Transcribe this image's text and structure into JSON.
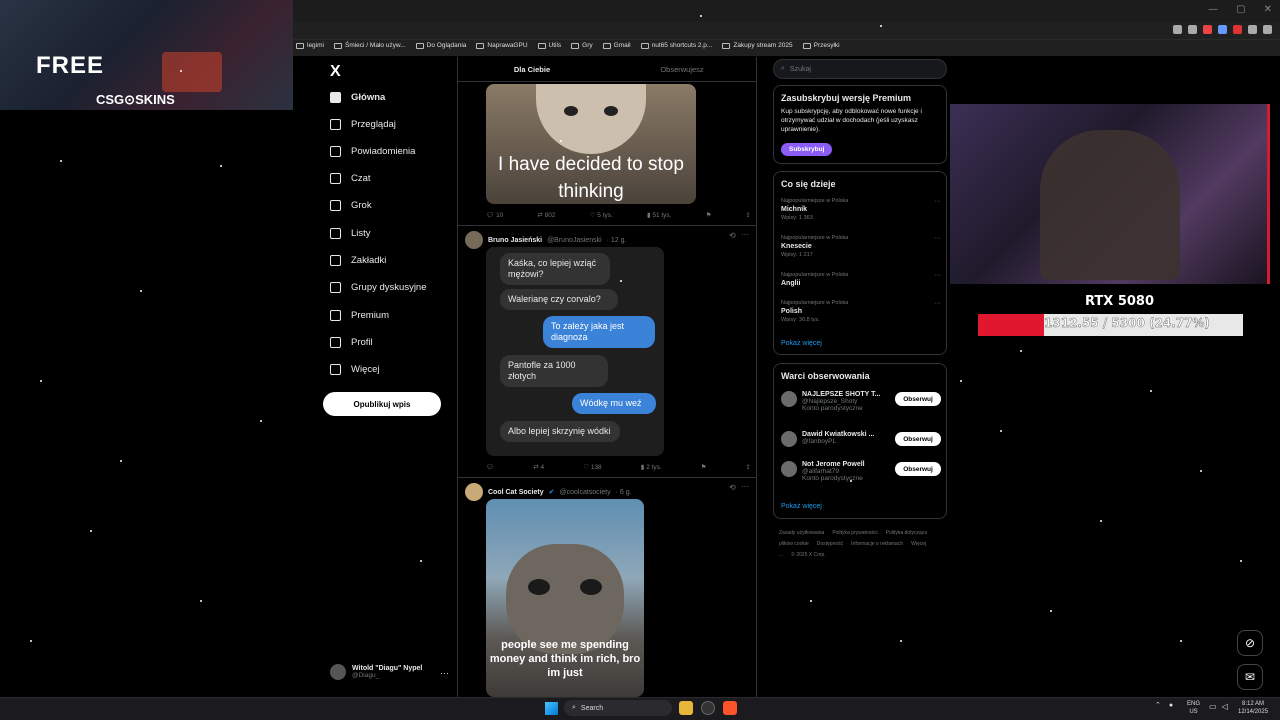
{
  "bookmarks": [
    "legimi",
    "Śmieci / Mało używ...",
    "Do Oglądania",
    "NaprawaGPU",
    "Utils",
    "Gry",
    "Gmail",
    "nut65 shortcuts 2.p...",
    "Zakupy stream 2025",
    "Przesyłki"
  ],
  "promo": {
    "headline": "FREE",
    "brand": "CSG⊙SKINS"
  },
  "sidebar": {
    "logo": "X",
    "items": [
      {
        "label": "Główna",
        "icon": "home-icon"
      },
      {
        "label": "Przeglądaj",
        "icon": "search-icon"
      },
      {
        "label": "Powiadomienia",
        "icon": "bell-icon"
      },
      {
        "label": "Czat",
        "icon": "mail-icon"
      },
      {
        "label": "Grok",
        "icon": "grok-icon"
      },
      {
        "label": "Listy",
        "icon": "list-icon"
      },
      {
        "label": "Zakładki",
        "icon": "bookmark-icon"
      },
      {
        "label": "Grupy dyskusyjne",
        "icon": "people-icon"
      },
      {
        "label": "Premium",
        "icon": "x-icon"
      },
      {
        "label": "Profil",
        "icon": "user-icon"
      },
      {
        "label": "Więcej",
        "icon": "more-icon"
      }
    ],
    "post_button": "Opublikuj wpis",
    "account": {
      "name": "Witold \"Diagu\" Nypel",
      "handle": "@Diagu_"
    }
  },
  "feed": {
    "tabs": [
      "Dla Ciebie",
      "Obserwujesz"
    ],
    "post1": {
      "image_text": "I have decided to stop thinking",
      "replies": "10",
      "reposts": "802",
      "likes": "5 tys.",
      "views": "51 tys."
    },
    "post2": {
      "author": "Bruno Jasieński",
      "handle": "@BrunoJasienski",
      "time": "· 12 g.",
      "messages": [
        {
          "text": "Kaśka, co lepiej wziąć mężowi?",
          "dir": "in"
        },
        {
          "text": "Walerianę czy corvalo?",
          "dir": "in"
        },
        {
          "text": "To zależy jaka jest diagnoza",
          "dir": "out"
        },
        {
          "text": "Pantofle za 1000 złotych",
          "dir": "in"
        },
        {
          "text": "Wódkę mu weź",
          "dir": "out"
        },
        {
          "text": "Albo lepiej skrzynię wódki",
          "dir": "in"
        }
      ],
      "replies": "",
      "reposts": "4",
      "likes": "138",
      "views": "2 tys."
    },
    "post3": {
      "author": "Cool Cat Society",
      "handle": "@coolcatsociety",
      "time": "· 6 g.",
      "image_text": "people see me spending money and think im rich, bro im just"
    }
  },
  "right": {
    "search_placeholder": "Szukaj",
    "premium": {
      "title": "Zasubskrybuj wersję Premium",
      "text": "Kup subskrypcję, aby odblokować nowe funkcje i otrzymywać udział w dochodach (jeśli uzyskasz uprawnienie).",
      "button": "Subskrybuj"
    },
    "trends": {
      "title": "Co się dzieje",
      "items": [
        {
          "context": "Najpopularniejsze w Polska",
          "name": "Michnik",
          "count": "Wpisy: 1 363"
        },
        {
          "context": "Najpopularniejsze w Polska",
          "name": "Knesecie",
          "count": "Wpisy: 1 217"
        },
        {
          "context": "Najpopularniejsze w Polska",
          "name": "Anglii",
          "count": ""
        },
        {
          "context": "Najpopularniejsze w Polska",
          "name": "Polish",
          "count": "Wpisy: 30,8 tys."
        }
      ],
      "more": "Pokaż więcej"
    },
    "who_to_follow": {
      "title": "Warci obserwowania",
      "items": [
        {
          "name": "NAJLEPSZE SHOTY T...",
          "handle": "@Najlepsze_Shoty",
          "badge": "Konto parodystyczne",
          "button": "Obserwuj"
        },
        {
          "name": "Dawid Kwiatkowski ...",
          "handle": "@fanboyPL",
          "badge": "",
          "button": "Obserwuj"
        },
        {
          "name": "Not Jerome Powell",
          "handle": "@alifarhat79",
          "badge": "Konto parodystyczne",
          "button": "Obserwuj"
        }
      ],
      "more": "Pokaż więcej"
    },
    "footer": [
      "Zasady użytkowania",
      "Polityka prywatności",
      "Polityka dotycząca plików cookie",
      "Dostępność",
      "Informacje o reklamach",
      "Więcej ...",
      "© 2025 X Corp."
    ]
  },
  "overlay": {
    "gpu_label": "RTX 5080",
    "progress_text": "1312.55 / 5300 (24.77%)",
    "progress_fraction": 0.2477,
    "bar_color": "#e0172e"
  },
  "taskbar": {
    "search": "Search",
    "lang": "ENG",
    "region": "US",
    "time": "8:12 AM",
    "date": "12/14/2025"
  }
}
